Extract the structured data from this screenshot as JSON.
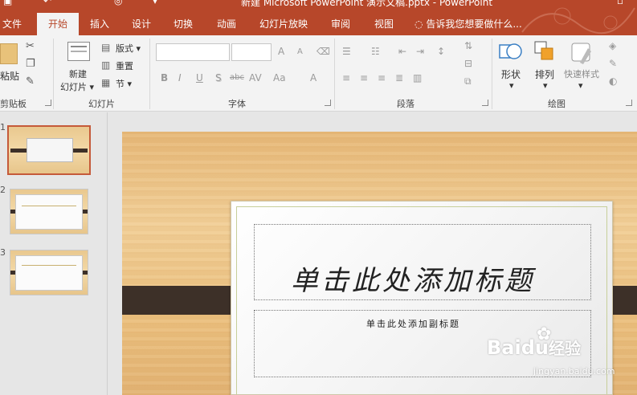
{
  "window": {
    "title": "新建 Microsoft PowerPoint 演示文稿.pptx - PowerPoint",
    "accent": "#b7472a"
  },
  "tabs": [
    {
      "label": "文件"
    },
    {
      "label": "开始",
      "active": true
    },
    {
      "label": "插入"
    },
    {
      "label": "设计"
    },
    {
      "label": "切换"
    },
    {
      "label": "动画"
    },
    {
      "label": "幻灯片放映"
    },
    {
      "label": "审阅"
    },
    {
      "label": "视图"
    }
  ],
  "tellme": {
    "icon": "lightbulb-icon",
    "placeholder": "告诉我您想要做什么..."
  },
  "ribbon": {
    "clipboard": {
      "paste_label": "粘贴",
      "group_label": "剪贴板"
    },
    "slides": {
      "new_slide_label_1": "新建",
      "new_slide_label_2": "幻灯片",
      "layout_label": "版式",
      "reset_label": "重置",
      "section_label": "节",
      "group_label": "幻灯片"
    },
    "font": {
      "group_label": "字体",
      "bold": "B",
      "italic": "I",
      "underline": "U",
      "shadow": "S",
      "strike": "abc",
      "spacing": "AV",
      "case": "Aa",
      "color": "A",
      "grow": "A",
      "shrink": "A"
    },
    "paragraph": {
      "group_label": "段落"
    },
    "drawing": {
      "shapes_label": "形状",
      "arrange_label": "排列",
      "quick_styles_label": "快速样式",
      "group_label": "绘图"
    }
  },
  "thumbnails": [
    {
      "number": "1",
      "selected": true
    },
    {
      "number": "2"
    },
    {
      "number": "3"
    }
  ],
  "slide": {
    "title_placeholder": "单击此处添加标题",
    "subtitle_placeholder": "单击此处添加副标题"
  },
  "watermark": {
    "brand": "Baidu",
    "brand_suffix": "经验",
    "url": "jingyan.baidu.com"
  }
}
